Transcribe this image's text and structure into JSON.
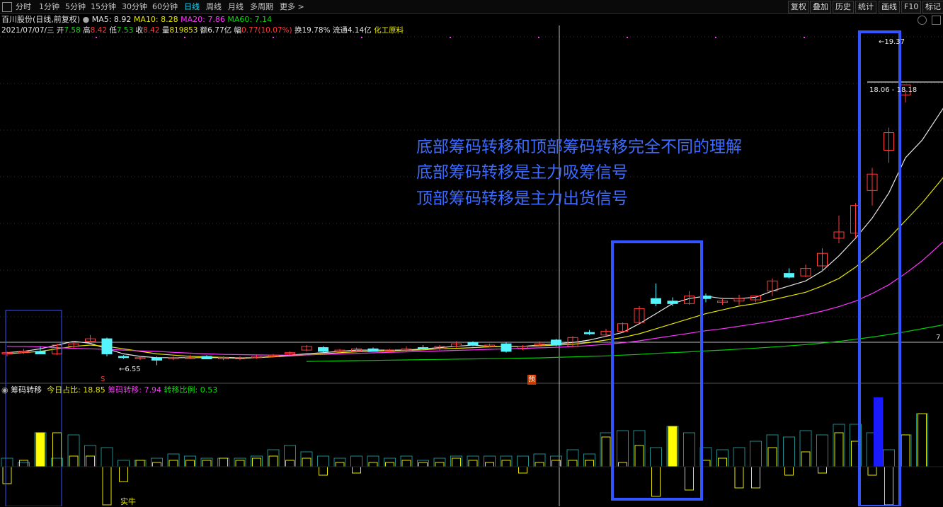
{
  "toolbar": {
    "periods": [
      "分时",
      "1分钟",
      "5分钟",
      "15分钟",
      "30分钟",
      "60分钟",
      "日线",
      "周线",
      "月线",
      "多周期",
      "更多 >"
    ],
    "active_period": "日线",
    "right_buttons": [
      "复权",
      "叠加",
      "历史",
      "统计",
      "画线",
      "F10",
      "标记"
    ]
  },
  "header1": {
    "stock": "百川股份(日线,前复权)",
    "ma5": "MA5: 8.92",
    "ma10": "MA10: 8.28",
    "ma20": "MA20: 7.86",
    "ma60": "MA60: 7.14"
  },
  "header2": {
    "date": "2021/07/07/三",
    "open_label": "开",
    "open": "7.58",
    "high_label": "高",
    "high": "8.42",
    "low_label": "低",
    "low": "7.53",
    "close_label": "收",
    "close": "8.42",
    "vol_label": "量",
    "vol": "819853",
    "amt_label": "额",
    "amt": "6.77亿",
    "chg_label": "幅",
    "chg": "0.77(10.07%)",
    "turn_label": "换",
    "turn": "19.78%",
    "float_label": "流通",
    "float": "4.14亿",
    "sector": "化工原料"
  },
  "annotations": {
    "line1": "底部筹码转移和顶部筹码转移完全不同的理解",
    "line2": "底部筹码转移是主力吸筹信号",
    "line3": "顶部筹码转移是主力出货信号"
  },
  "price_labels": {
    "high_marker": "19.37",
    "low_marker": "6.55",
    "price_box": "18.06 - 18.18",
    "right_edge": "7"
  },
  "markers": {
    "s_marker": "S",
    "yu_marker": "预"
  },
  "indicator": {
    "name": "筹码转移",
    "today_label": "今日占比: 18.85",
    "chip_label": "筹码转移: 7.94",
    "ratio_label": "转移比例: 0.53",
    "bottom_text": "实牛"
  },
  "colors": {
    "up": "#ff3b3b",
    "down": "#55f5ff",
    "ma5": "#e6e6e6",
    "ma10": "#e6e600",
    "ma20": "#ff33ff",
    "ma60": "#00d000",
    "annotation_box": "#3355ff",
    "annotation_text": "#3d6bff"
  },
  "chart_data": {
    "type": "candlestick",
    "candles": [
      [
        7.0,
        7.1,
        6.9,
        7.05
      ],
      [
        7.05,
        7.2,
        7.0,
        7.1
      ],
      [
        7.1,
        7.3,
        7.0,
        7.0
      ],
      [
        7.0,
        7.4,
        6.95,
        7.35
      ],
      [
        7.3,
        7.5,
        7.2,
        7.4
      ],
      [
        7.5,
        7.75,
        7.45,
        7.6
      ],
      [
        7.6,
        7.65,
        6.9,
        7.0
      ],
      [
        6.9,
        6.95,
        6.8,
        6.85
      ],
      [
        6.85,
        6.9,
        6.75,
        6.85
      ],
      [
        6.85,
        6.9,
        6.55,
        6.75
      ],
      [
        6.8,
        6.9,
        6.75,
        6.85
      ],
      [
        6.85,
        6.95,
        6.8,
        6.85
      ],
      [
        6.9,
        6.95,
        6.8,
        6.8
      ],
      [
        6.8,
        6.9,
        6.75,
        6.85
      ],
      [
        6.8,
        6.9,
        6.75,
        6.85
      ],
      [
        6.85,
        6.95,
        6.8,
        6.9
      ],
      [
        6.9,
        7.0,
        6.85,
        6.95
      ],
      [
        7.0,
        7.1,
        6.95,
        7.05
      ],
      [
        7.15,
        7.35,
        7.1,
        7.3
      ],
      [
        7.25,
        7.3,
        7.05,
        7.1
      ],
      [
        7.1,
        7.2,
        7.05,
        7.15
      ],
      [
        7.1,
        7.25,
        7.05,
        7.2
      ],
      [
        7.2,
        7.25,
        7.1,
        7.1
      ],
      [
        7.1,
        7.2,
        7.05,
        7.15
      ],
      [
        7.15,
        7.3,
        7.1,
        7.2
      ],
      [
        7.25,
        7.35,
        7.15,
        7.2
      ],
      [
        7.2,
        7.35,
        7.15,
        7.3
      ],
      [
        7.3,
        7.5,
        7.25,
        7.4
      ],
      [
        7.45,
        7.5,
        7.3,
        7.35
      ],
      [
        7.3,
        7.4,
        7.25,
        7.35
      ],
      [
        7.4,
        7.45,
        7.05,
        7.1
      ],
      [
        7.2,
        7.35,
        7.15,
        7.3
      ],
      [
        7.35,
        7.5,
        7.3,
        7.4
      ],
      [
        7.55,
        7.6,
        7.3,
        7.35
      ],
      [
        7.3,
        7.7,
        7.3,
        7.65
      ],
      [
        7.85,
        7.95,
        7.75,
        7.8
      ],
      [
        7.75,
        8.0,
        7.7,
        7.9
      ],
      [
        7.9,
        8.25,
        7.85,
        8.2
      ],
      [
        8.25,
        8.9,
        8.2,
        8.8
      ],
      [
        9.2,
        9.8,
        8.9,
        9.0
      ],
      [
        9.1,
        9.25,
        8.9,
        9.0
      ],
      [
        9.0,
        9.5,
        8.95,
        9.3
      ],
      [
        9.3,
        9.4,
        9.05,
        9.2
      ],
      [
        9.05,
        9.2,
        8.95,
        9.1
      ],
      [
        9.1,
        9.35,
        8.95,
        9.2
      ],
      [
        9.15,
        9.3,
        9.05,
        9.3
      ],
      [
        9.5,
        10.0,
        9.3,
        9.9
      ],
      [
        10.2,
        10.4,
        10.0,
        10.05
      ],
      [
        10.1,
        10.55,
        10.05,
        10.4
      ],
      [
        10.5,
        11.2,
        10.3,
        11.0
      ],
      [
        11.6,
        12.5,
        11.4,
        11.85
      ],
      [
        11.8,
        13.0,
        11.6,
        12.9
      ],
      [
        13.5,
        14.4,
        12.9,
        14.15
      ],
      [
        15.1,
        16.0,
        14.6,
        15.8
      ],
      [
        17.3,
        17.5,
        17.0,
        17.7
      ],
      [],
      [],
      [
        18.06,
        19.37,
        18.0,
        18.18
      ]
    ],
    "ma5": [
      7.05,
      7.1,
      7.2,
      7.35,
      7.5,
      7.42,
      7.2,
      7.0,
      6.9,
      6.85,
      6.85,
      6.85,
      6.85,
      6.85,
      6.82,
      6.85,
      6.9,
      6.95,
      7.0,
      7.05,
      7.1,
      7.15,
      7.15,
      7.15,
      7.15,
      7.2,
      7.25,
      7.3,
      7.35,
      7.3,
      7.3,
      7.3,
      7.35,
      7.4,
      7.45,
      7.55,
      7.7,
      7.85,
      8.2,
      8.6,
      9.0,
      9.2,
      9.3,
      9.2,
      9.2,
      9.25,
      9.5,
      9.7,
      9.9,
      10.3,
      10.9,
      11.6,
      12.4,
      13.4,
      14.8,
      15.5,
      16.5,
      17.5
    ],
    "ma10": [
      7.0,
      7.05,
      7.1,
      7.2,
      7.3,
      7.35,
      7.3,
      7.2,
      7.1,
      7.0,
      6.95,
      6.9,
      6.88,
      6.86,
      6.85,
      6.85,
      6.88,
      6.92,
      6.96,
      7.0,
      7.05,
      7.08,
      7.1,
      7.12,
      7.14,
      7.16,
      7.2,
      7.22,
      7.25,
      7.28,
      7.3,
      7.3,
      7.32,
      7.35,
      7.38,
      7.45,
      7.55,
      7.65,
      7.8,
      8.0,
      8.2,
      8.4,
      8.6,
      8.75,
      8.9,
      9.0,
      9.15,
      9.3,
      9.45,
      9.7,
      10.0,
      10.45,
      11.0,
      11.6,
      12.3,
      13.0,
      13.8,
      14.6
    ],
    "ma20": [
      7.3,
      7.3,
      7.28,
      7.25,
      7.22,
      7.2,
      7.18,
      7.15,
      7.12,
      7.1,
      7.06,
      7.03,
      7.0,
      6.98,
      6.97,
      6.96,
      6.95,
      6.95,
      6.96,
      6.98,
      7.0,
      7.02,
      7.04,
      7.06,
      7.08,
      7.1,
      7.12,
      7.14,
      7.16,
      7.18,
      7.2,
      7.22,
      7.24,
      7.26,
      7.29,
      7.33,
      7.38,
      7.44,
      7.52,
      7.62,
      7.72,
      7.82,
      7.92,
      8.0,
      8.1,
      8.2,
      8.3,
      8.42,
      8.55,
      8.7,
      8.88,
      9.1,
      9.4,
      9.75,
      10.2,
      10.7,
      11.3,
      11.9
    ],
    "ma60": [
      null,
      null,
      null,
      null,
      null,
      null,
      null,
      null,
      null,
      null,
      null,
      null,
      null,
      null,
      null,
      null,
      null,
      null,
      6.7,
      6.71,
      6.72,
      6.73,
      6.74,
      6.75,
      6.76,
      6.77,
      6.78,
      6.79,
      6.8,
      6.81,
      6.82,
      6.83,
      6.84,
      6.86,
      6.88,
      6.9,
      6.92,
      6.95,
      6.98,
      7.02,
      7.05,
      7.08,
      7.12,
      7.15,
      7.19,
      7.23,
      7.27,
      7.32,
      7.37,
      7.43,
      7.5,
      7.58,
      7.67,
      7.77,
      7.88,
      8.0,
      8.12,
      8.25
    ],
    "indicator_bars": [
      [
        -0.8,
        0.4
      ],
      [
        0.3,
        0.2
      ],
      [
        1.6,
        1.6
      ],
      [
        1.6,
        0.4
      ],
      [
        0.5,
        1.5
      ],
      [
        0.5,
        1.0
      ],
      [
        -1.8,
        0.9
      ],
      [
        -0.7,
        0.3
      ],
      [
        0.3,
        0.3
      ],
      [
        0.2,
        0.4
      ],
      [
        0.3,
        0.6
      ],
      [
        0.3,
        0.5
      ],
      [
        0.3,
        0.4
      ],
      [
        0.4,
        0.4
      ],
      [
        0.3,
        0.4
      ],
      [
        0.4,
        0.5
      ],
      [
        0.5,
        0.8
      ],
      [
        0.3,
        1.0
      ],
      [
        0.4,
        0.7
      ],
      [
        -0.4,
        0.5
      ],
      [
        0.2,
        0.4
      ],
      [
        -0.3,
        0.5
      ],
      [
        0.2,
        0.5
      ],
      [
        0.2,
        0.4
      ],
      [
        0.3,
        0.5
      ],
      [
        0.2,
        0.3
      ],
      [
        0.2,
        0.4
      ],
      [
        0.4,
        0.5
      ],
      [
        0.3,
        0.5
      ],
      [
        0.2,
        0.5
      ],
      [
        0.3,
        0.5
      ],
      [
        -0.3,
        0.5
      ],
      [
        0.2,
        0.6
      ],
      [
        0.3,
        0.5
      ],
      [
        0.3,
        0.8
      ],
      [
        0.3,
        0.6
      ],
      [
        1.4,
        1.6
      ],
      [
        0.2,
        1.7
      ],
      [
        1.0,
        1.7
      ],
      [
        -1.4,
        0.9
      ],
      [
        1.9,
        1.9
      ],
      [
        -1.1,
        1.6
      ],
      [
        0.3,
        0.9
      ],
      [
        0.4,
        0.8
      ],
      [
        -1.0,
        0.9
      ],
      [
        -1.0,
        1.2
      ],
      [
        0.9,
        1.5
      ],
      [
        -0.4,
        1.4
      ],
      [
        0.7,
        1.7
      ],
      [
        -0.3,
        1.5
      ],
      [
        1.6,
        2.0
      ],
      [
        1.2,
        2.0
      ],
      [
        -0.4,
        1.6
      ],
      [
        -1.8,
        0.8
      ],
      [
        1.5,
        1.5
      ],
      [
        2.5,
        2.5
      ]
    ]
  }
}
